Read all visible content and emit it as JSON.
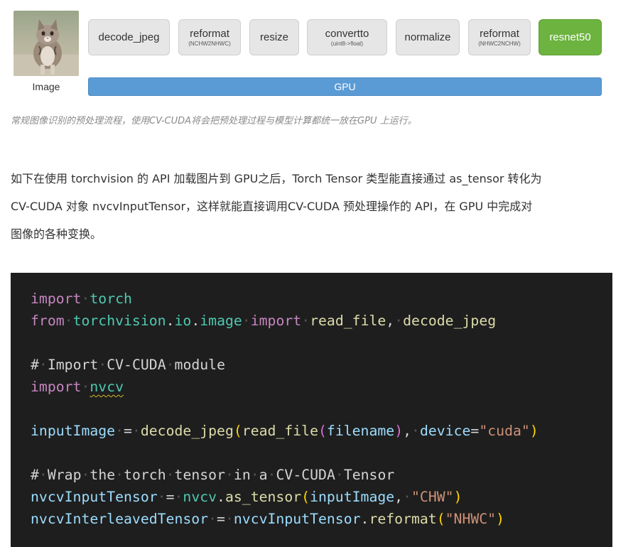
{
  "figure": {
    "image_label": "Image",
    "steps": [
      {
        "title": "decode_jpeg",
        "sub": ""
      },
      {
        "title": "reformat",
        "sub": "(NCHW2NHWC)"
      },
      {
        "title": "resize",
        "sub": ""
      },
      {
        "title": "convertto",
        "sub": "(uint8->float)"
      },
      {
        "title": "normalize",
        "sub": ""
      },
      {
        "title": "reformat",
        "sub": "(NHWC2NCHW)"
      },
      {
        "title": "resnet50",
        "sub": ""
      }
    ],
    "gpu_label": "GPU",
    "caption": "常规图像识别的预处理流程，使用CV-CUDA将会把预处理过程与模型计算都统一放在GPU 上运行。"
  },
  "paragraph": {
    "line1": "如下在使用 torchvision 的 API 加载图片到 GPU之后，Torch Tensor 类型能直接通过 as_tensor 转化为",
    "line2": "CV-CUDA 对象 nvcvInputTensor，这样就能直接调用CV-CUDA 预处理操作的 API，在 GPU 中完成对",
    "line3": "图像的各种变换。"
  },
  "code": {
    "l1": {
      "kw": "import",
      "mod": "torch"
    },
    "l2": {
      "kw1": "from",
      "mod": "torchvision",
      "sub1": "io",
      "sub2": "image",
      "kw2": "import",
      "f1": "read_file",
      "f2": "decode_jpeg"
    },
    "l3": "# Import CV-CUDA module",
    "l4": {
      "kw": "import",
      "mod": "nvcv"
    },
    "l5": {
      "var": "inputImage",
      "eq": "=",
      "fn": "decode_jpeg",
      "fn2": "read_file",
      "arg": "filename",
      "kwarg": "device",
      "str": "\"cuda\""
    },
    "l6": "# Wrap the torch tensor in a CV-CUDA Tensor",
    "l7": {
      "var": "nvcvInputTensor",
      "eq": "=",
      "mod": "nvcv",
      "fn": "as_tensor",
      "arg": "inputImage",
      "str": "\"CHW\""
    },
    "l8": {
      "var": "nvcvInterleavedTensor",
      "eq": "=",
      "obj": "nvcvInputTensor",
      "fn": "reformat",
      "str": "\"NHWC\""
    }
  },
  "colors": {
    "green_step": "#6db33f",
    "gpu_bar": "#5b9bd5",
    "code_bg": "#1e1e1e"
  }
}
